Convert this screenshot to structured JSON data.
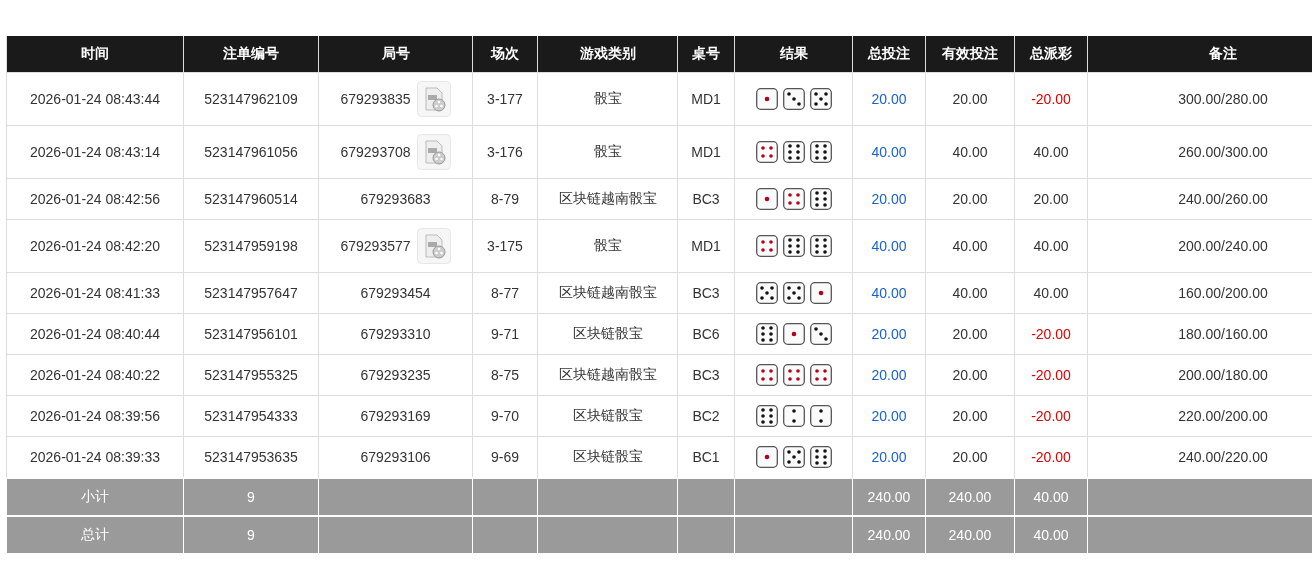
{
  "table": {
    "columns": [
      "时间",
      "注单编号",
      "局号",
      "场次",
      "游戏类别",
      "桌号",
      "结果",
      "总投注",
      "有效投注",
      "总派彩",
      "备注"
    ],
    "rows": [
      {
        "time": "2026-01-24 08:43:44",
        "bet_no": "523147962109",
        "round_no": "679293835",
        "replay": true,
        "session": "3-177",
        "game": "骰宝",
        "table": "MD1",
        "dice": [
          {
            "kind": "one"
          },
          {
            "kind": "three"
          },
          {
            "kind": "five"
          }
        ],
        "bet": "20.00",
        "valid_bet": "20.00",
        "payout": "-20.00",
        "loss": true,
        "note": "300.00/280.00"
      },
      {
        "time": "2026-01-24 08:43:14",
        "bet_no": "523147961056",
        "round_no": "679293708",
        "replay": true,
        "session": "3-176",
        "game": "骰宝",
        "table": "MD1",
        "dice": [
          {
            "kind": "four"
          },
          {
            "kind": "six"
          },
          {
            "kind": "six"
          }
        ],
        "bet": "40.00",
        "valid_bet": "40.00",
        "payout": "40.00",
        "loss": false,
        "note": "260.00/300.00"
      },
      {
        "time": "2026-01-24 08:42:56",
        "bet_no": "523147960514",
        "round_no": "679293683",
        "replay": false,
        "session": "8-79",
        "game": "区块链越南骰宝",
        "table": "BC3",
        "dice": [
          {
            "kind": "one"
          },
          {
            "kind": "four"
          },
          {
            "kind": "six"
          }
        ],
        "bet": "20.00",
        "valid_bet": "20.00",
        "payout": "20.00",
        "loss": false,
        "note": "240.00/260.00"
      },
      {
        "time": "2026-01-24 08:42:20",
        "bet_no": "523147959198",
        "round_no": "679293577",
        "replay": true,
        "session": "3-175",
        "game": "骰宝",
        "table": "MD1",
        "dice": [
          {
            "kind": "four"
          },
          {
            "kind": "six"
          },
          {
            "kind": "six"
          }
        ],
        "bet": "40.00",
        "valid_bet": "40.00",
        "payout": "40.00",
        "loss": false,
        "note": "200.00/240.00"
      },
      {
        "time": "2026-01-24 08:41:33",
        "bet_no": "523147957647",
        "round_no": "679293454",
        "replay": false,
        "session": "8-77",
        "game": "区块链越南骰宝",
        "table": "BC3",
        "dice": [
          {
            "kind": "five"
          },
          {
            "kind": "five"
          },
          {
            "kind": "one"
          }
        ],
        "bet": "40.00",
        "valid_bet": "40.00",
        "payout": "40.00",
        "loss": false,
        "note": "160.00/200.00"
      },
      {
        "time": "2026-01-24 08:40:44",
        "bet_no": "523147956101",
        "round_no": "679293310",
        "replay": false,
        "session": "9-71",
        "game": "区块链骰宝",
        "table": "BC6",
        "dice": [
          {
            "kind": "six"
          },
          {
            "kind": "one"
          },
          {
            "kind": "three"
          }
        ],
        "bet": "20.00",
        "valid_bet": "20.00",
        "payout": "-20.00",
        "loss": true,
        "note": "180.00/160.00"
      },
      {
        "time": "2026-01-24 08:40:22",
        "bet_no": "523147955325",
        "round_no": "679293235",
        "replay": false,
        "session": "8-75",
        "game": "区块链越南骰宝",
        "table": "BC3",
        "dice": [
          {
            "kind": "four"
          },
          {
            "kind": "four"
          },
          {
            "kind": "four"
          }
        ],
        "bet": "20.00",
        "valid_bet": "20.00",
        "payout": "-20.00",
        "loss": true,
        "note": "200.00/180.00"
      },
      {
        "time": "2026-01-24 08:39:56",
        "bet_no": "523147954333",
        "round_no": "679293169",
        "replay": false,
        "session": "9-70",
        "game": "区块链骰宝",
        "table": "BC2",
        "dice": [
          {
            "kind": "six"
          },
          {
            "kind": "two"
          },
          {
            "kind": "two"
          }
        ],
        "bet": "20.00",
        "valid_bet": "20.00",
        "payout": "-20.00",
        "loss": true,
        "note": "220.00/200.00"
      },
      {
        "time": "2026-01-24 08:39:33",
        "bet_no": "523147953635",
        "round_no": "679293106",
        "replay": false,
        "session": "9-69",
        "game": "区块链骰宝",
        "table": "BC1",
        "dice": [
          {
            "kind": "one"
          },
          {
            "kind": "five"
          },
          {
            "kind": "six"
          }
        ],
        "bet": "20.00",
        "valid_bet": "20.00",
        "payout": "-20.00",
        "loss": true,
        "note": "240.00/220.00"
      }
    ],
    "summary": [
      {
        "label": "小计",
        "count": "9",
        "bet": "240.00",
        "valid_bet": "240.00",
        "payout": "40.00"
      },
      {
        "label": "总计",
        "count": "9",
        "bet": "240.00",
        "valid_bet": "240.00",
        "payout": "40.00"
      }
    ]
  }
}
